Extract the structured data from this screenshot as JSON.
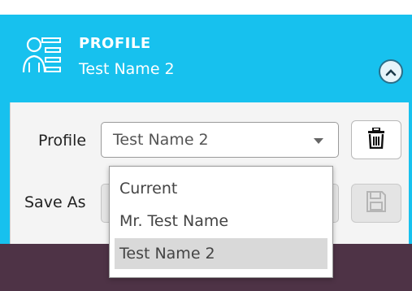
{
  "header": {
    "title": "PROFILE",
    "subtitle": "Test Name 2",
    "icon": "user-list-icon",
    "collapse_icon": "chevron-up-icon"
  },
  "form": {
    "profile_label": "Profile",
    "profile_value": "Test Name 2",
    "save_as_label": "Save As",
    "delete_icon": "trash-icon",
    "save_icon": "floppy-disk-icon"
  },
  "dropdown": {
    "options": [
      "Current",
      "Mr. Test Name",
      "Test Name 2"
    ],
    "selected": "Test Name 2"
  },
  "colors": {
    "accent": "#17c1ee",
    "panel": "#f4f4f4",
    "footer": "#4e3346"
  }
}
